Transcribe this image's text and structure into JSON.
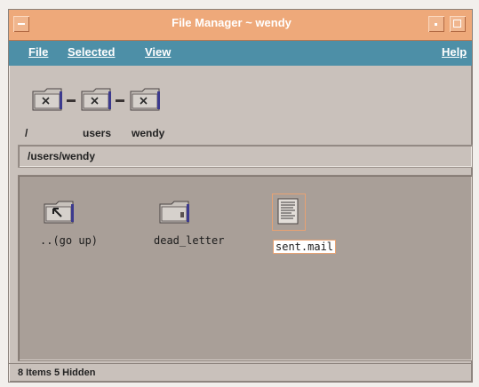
{
  "window": {
    "title": "File Manager ~ wendy"
  },
  "menubar": {
    "file": "File",
    "selected": "Selected",
    "view": "View",
    "help": "Help"
  },
  "breadcrumbs": [
    {
      "label": "/"
    },
    {
      "label": "users"
    },
    {
      "label": "wendy"
    }
  ],
  "path": {
    "value": "/users/wendy"
  },
  "files": [
    {
      "label": "..(go up)",
      "icon": "go-up-folder-icon"
    },
    {
      "label": "dead_letter",
      "icon": "folder-icon"
    },
    {
      "label": "sent.mail",
      "icon": "document-icon",
      "selected": true
    }
  ],
  "status": {
    "text": "8 Items 5 Hidden"
  },
  "colors": {
    "titlebar": "#eea97a",
    "menubar": "#4d8fa7",
    "window_bg": "#c9c1bb",
    "file_area_bg": "#a99f98"
  }
}
